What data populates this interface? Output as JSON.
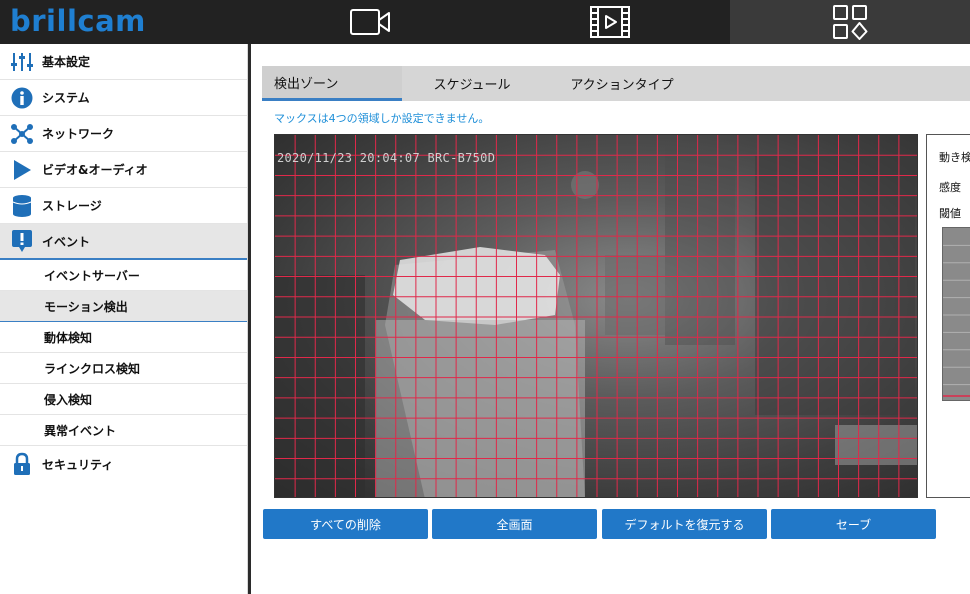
{
  "header": {
    "logo": "brillcam",
    "nav": [
      {
        "name": "live-view",
        "icon": "video-camera-icon"
      },
      {
        "name": "playback",
        "icon": "film-playback-icon"
      },
      {
        "name": "settings",
        "icon": "apps-grid-icon",
        "active": true
      }
    ]
  },
  "sidebar": {
    "items": [
      {
        "label": "基本設定",
        "icon": "sliders-icon"
      },
      {
        "label": "システム",
        "icon": "info-icon"
      },
      {
        "label": "ネットワーク",
        "icon": "network-icon"
      },
      {
        "label": "ビデオ&オーディオ",
        "icon": "play-icon"
      },
      {
        "label": "ストレージ",
        "icon": "database-icon"
      },
      {
        "label": "イベント",
        "icon": "alert-icon",
        "expanded": true
      },
      {
        "label": "セキュリティ",
        "icon": "lock-icon"
      }
    ],
    "event_subitems": [
      {
        "label": "イベントサーバー"
      },
      {
        "label": "モーション検出",
        "active": true
      },
      {
        "label": "動体検知"
      },
      {
        "label": "ラインクロス検知"
      },
      {
        "label": "侵入検知"
      },
      {
        "label": "異常イベント"
      }
    ]
  },
  "main": {
    "tabs": [
      {
        "label": "検出ゾーン",
        "active": true
      },
      {
        "label": "スケジュール"
      },
      {
        "label": "アクションタイプ"
      }
    ],
    "notice": "マックスは4つの領域しか設定できません。",
    "video": {
      "osd_text": "2020/11/23 20:04:07 BRC-B750D",
      "grid_cols": 32,
      "grid_rows": 18,
      "grid_color": "#e0294a"
    },
    "side_panel": {
      "motion_label": "動き検",
      "sensitivity_label": "感度",
      "threshold_label": "閾値"
    },
    "buttons": {
      "delete_all": "すべての削除",
      "full_screen": "全画面",
      "restore_default": "デフォルトを復元する",
      "save": "セーブ"
    }
  },
  "colors": {
    "accent": "#2178c8",
    "topbar": "#222222",
    "notice": "#1f8fd8"
  }
}
